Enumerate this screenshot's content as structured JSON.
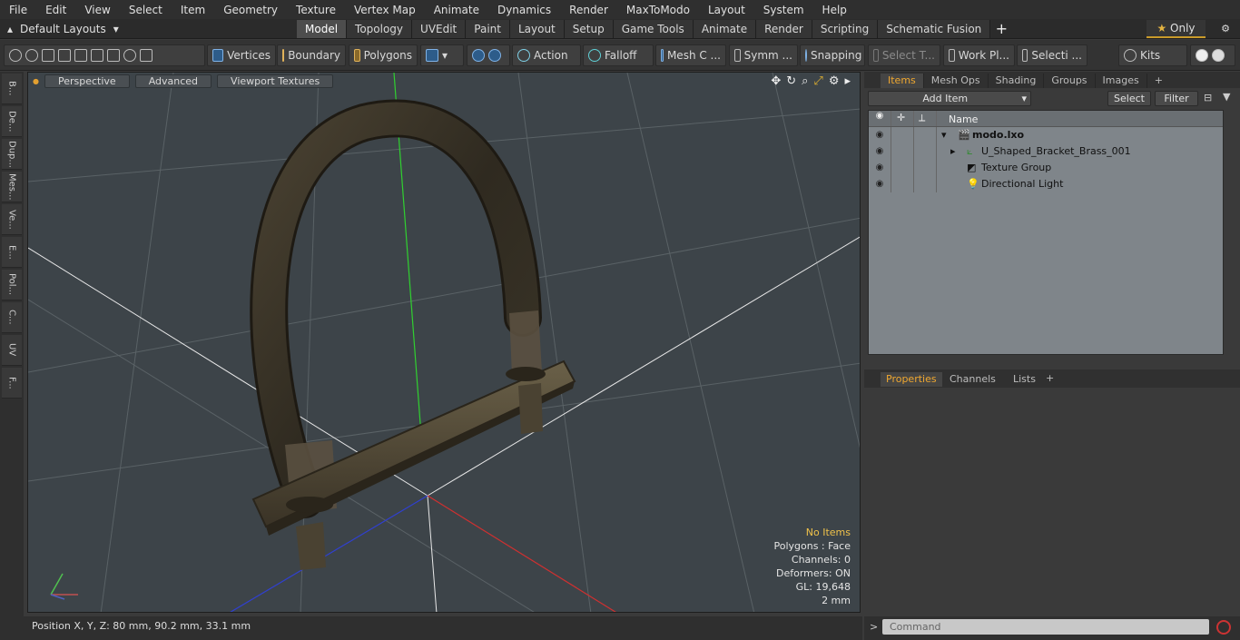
{
  "menu": [
    "File",
    "Edit",
    "View",
    "Select",
    "Item",
    "Geometry",
    "Texture",
    "Vertex Map",
    "Animate",
    "Dynamics",
    "Render",
    "MaxToModo",
    "Layout",
    "System",
    "Help"
  ],
  "layouts_label": "Default Layouts",
  "tabs": [
    "Model",
    "Topology",
    "UVEdit",
    "Paint",
    "Layout",
    "Setup",
    "Game Tools",
    "Animate",
    "Render",
    "Scripting",
    "Schematic Fusion"
  ],
  "only_label": "Only",
  "toolbar": {
    "vertices": "Vertices",
    "boundary": "Boundary",
    "polygons": "Polygons",
    "action": "Action",
    "falloff": "Falloff",
    "mesh": "Mesh C ...",
    "symm": "Symm ...",
    "snapping": "Snapping",
    "select_t": "Select T...",
    "workpl": "Work Pl...",
    "selecti": "Selecti ...",
    "kits": "Kits"
  },
  "left_tabs": [
    "B...",
    "De...",
    "Dup...",
    "Mes...",
    "Ve...",
    "E...",
    "Pol...",
    "C...",
    "UV",
    "F..."
  ],
  "viewport": {
    "perspective": "Perspective",
    "advanced": "Advanced",
    "textures": "Viewport Textures",
    "stats": {
      "no_items": "No Items",
      "polygons": "Polygons : Face",
      "channels": "Channels: 0",
      "deformers": "Deformers: ON",
      "gl": "GL: 19,648",
      "scale": "2 mm"
    }
  },
  "status": "Position X, Y, Z:   80 mm, 90.2 mm, 33.1 mm",
  "panel": {
    "tabs": [
      "Items",
      "Mesh Ops",
      "Shading",
      "Groups",
      "Images"
    ],
    "add_item": "Add Item",
    "select": "Select",
    "filter": "Filter",
    "name_header": "Name",
    "items": [
      {
        "label": "modo.lxo"
      },
      {
        "label": "U_Shaped_Bracket_Brass_001"
      },
      {
        "label": "Texture Group"
      },
      {
        "label": "Directional Light"
      }
    ],
    "prop_tabs": [
      "Properties",
      "Channels",
      "Lists"
    ],
    "command_placeholder": "Command"
  }
}
